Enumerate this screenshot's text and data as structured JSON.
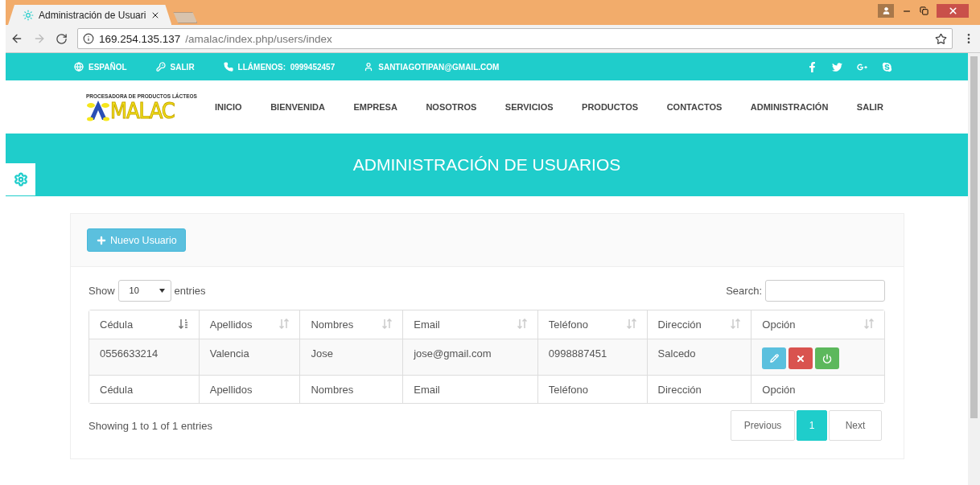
{
  "browser": {
    "tab_title": "Administración de Usuari",
    "url_host": "169.254.135.137",
    "url_path": "/amalac/index.php/users/index"
  },
  "topbar": [
    {
      "kind": "language",
      "label": "ESPAÑOL"
    },
    {
      "kind": "key",
      "label": "SALIR"
    },
    {
      "kind": "phone",
      "label": "LLÁMENOS:",
      "value": "0999452457"
    },
    {
      "kind": "user",
      "label": "SANTIAGOTIPAN@GMAIL.COM"
    }
  ],
  "logo": {
    "tagline": "PROCESADORA DE PRODUCTOS LÁCTEOS",
    "name": "MALAC"
  },
  "nav": [
    "INICIO",
    "BIENVENIDA",
    "EMPRESA",
    "NOSOTROS",
    "SERVICIOS",
    "PRODUCTOS",
    "CONTACTOS",
    "ADMINISTRACIÓN",
    "SALIR"
  ],
  "banner": {
    "title": "ADMINISTRACIÓN DE USUARIOS"
  },
  "new_button": "Nuevo Usuario",
  "controls": {
    "show_label": "Show",
    "page_length": "10",
    "entries_label": "entries",
    "search_label": "Search:"
  },
  "columns": [
    {
      "label": "Cédula",
      "sorted": true
    },
    {
      "label": "Apellidos",
      "sorted": false
    },
    {
      "label": "Nombres",
      "sorted": false
    },
    {
      "label": "Email",
      "sorted": false
    },
    {
      "label": "Teléfono",
      "sorted": false
    },
    {
      "label": "Dirección",
      "sorted": false
    },
    {
      "label": "Opción",
      "sorted": false
    }
  ],
  "rows": [
    {
      "cells": [
        "0556633214",
        "Valencia",
        "Jose",
        "jose@gmail.com",
        "0998887451",
        "Salcedo"
      ]
    }
  ],
  "footer": [
    "Cédula",
    "Apellidos",
    "Nombres",
    "Email",
    "Teléfono",
    "Dirección",
    "Opción"
  ],
  "info": "Showing 1 to 1 of 1 entries",
  "pagination": {
    "previous": "Previous",
    "pages": [
      {
        "label": "1",
        "selected": true
      }
    ],
    "next": "Next"
  }
}
